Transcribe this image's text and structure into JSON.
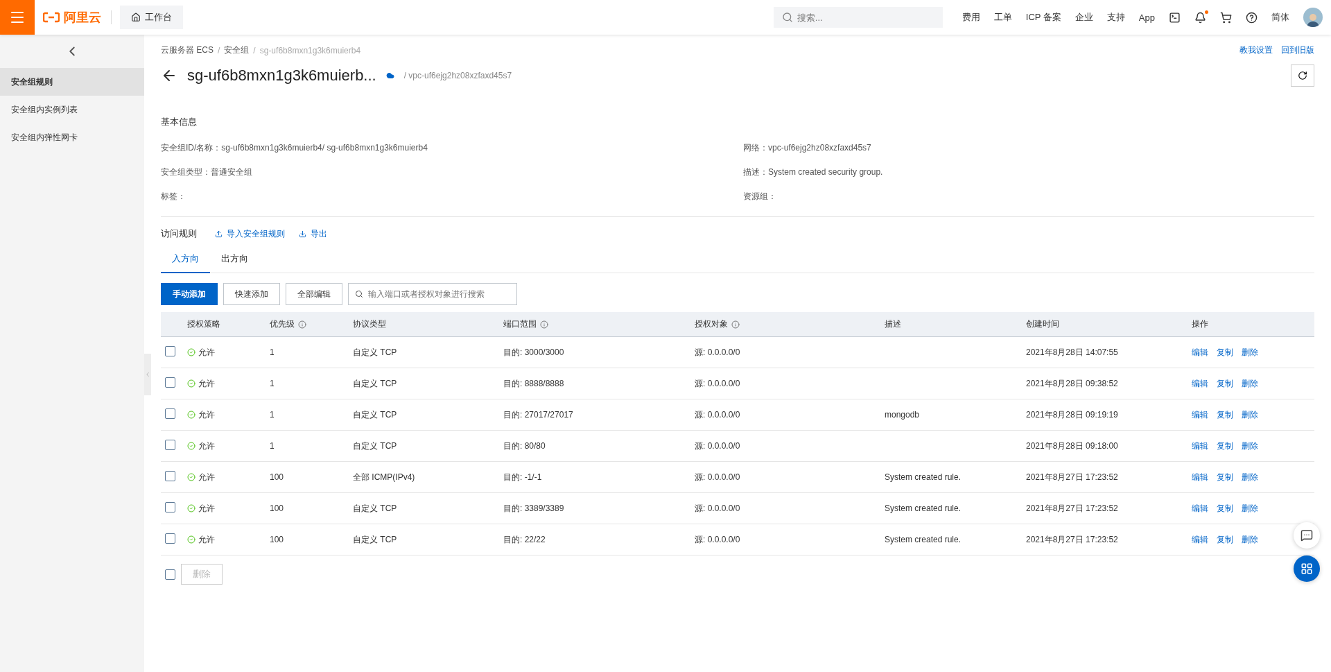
{
  "topbar": {
    "brand": "阿里云",
    "workbench": "工作台",
    "search": {
      "placeholder": "搜索..."
    },
    "links": [
      "费用",
      "工单",
      "ICP 备案",
      "企业",
      "支持",
      "App"
    ],
    "notification_dot": true,
    "language": "简体"
  },
  "sidebar": {
    "items": [
      {
        "label": "安全组规则",
        "selected": true
      },
      {
        "label": "安全组内实例列表",
        "selected": false
      },
      {
        "label": "安全组内弹性网卡",
        "selected": false
      }
    ]
  },
  "breadcrumb_separator": "/",
  "breadcrumb": [
    {
      "label": "云服务器 ECS",
      "current": false
    },
    {
      "label": "安全组",
      "current": false
    },
    {
      "label": "sg-uf6b8mxn1g3k6muierb4",
      "current": true
    }
  ],
  "header": {
    "title": "sg-uf6b8mxn1g3k6muierb...",
    "vpc": "/ vpc-uf6ejg2hz08xzfaxd45s7",
    "links": [
      "教我设置",
      "回到旧版"
    ]
  },
  "basic_info": {
    "title": "基本信息",
    "left": [
      {
        "label": "安全组ID/名称：",
        "value": "sg-uf6b8mxn1g3k6muierb4/ sg-uf6b8mxn1g3k6muierb4"
      },
      {
        "label": "安全组类型：",
        "value": "普通安全组"
      },
      {
        "label": "标签："
      }
    ],
    "right": [
      {
        "label": "网络：",
        "value": "vpc-uf6ejg2hz08xzfaxd45s7"
      },
      {
        "label": "描述：",
        "value": "System created security group."
      },
      {
        "label": "资源组："
      }
    ]
  },
  "access_rules": {
    "title": "访问规则",
    "actions": [
      "导入安全组规则",
      "导出"
    ]
  },
  "tabs": [
    {
      "label": "入方向",
      "selected": true
    },
    {
      "label": "出方向",
      "selected": false
    }
  ],
  "toolbar": {
    "buttons": [
      {
        "label": "手动添加",
        "kind": "primary"
      },
      {
        "label": "快速添加",
        "kind": "default"
      },
      {
        "label": "全部编辑",
        "kind": "default"
      }
    ],
    "search": {
      "placeholder": "输入端口或者授权对象进行搜索"
    }
  },
  "table": {
    "columns": [
      {
        "label": "授权策略",
        "info": false
      },
      {
        "label": "优先级",
        "info": true
      },
      {
        "label": "协议类型",
        "info": false
      },
      {
        "label": "端口范围",
        "info": true
      },
      {
        "label": "授权对象",
        "info": true
      },
      {
        "label": "描述",
        "info": false
      },
      {
        "label": "创建时间",
        "info": false
      },
      {
        "label": "操作",
        "info": false
      }
    ],
    "rows": [
      {
        "checked": false,
        "policy": "允许",
        "priority": "1",
        "protocol": "自定义 TCP",
        "port": "目的: 3000/3000",
        "source": "源: 0.0.0.0/0",
        "created": "2021年8月28日 14:07:55",
        "actions": [
          "编辑",
          "复制",
          "删除"
        ]
      },
      {
        "checked": false,
        "policy": "允许",
        "priority": "1",
        "protocol": "自定义 TCP",
        "port": "目的: 8888/8888",
        "source": "源: 0.0.0.0/0",
        "created": "2021年8月28日 09:38:52",
        "actions": [
          "编辑",
          "复制",
          "删除"
        ]
      },
      {
        "checked": false,
        "policy": "允许",
        "priority": "1",
        "protocol": "自定义 TCP",
        "port": "目的: 27017/27017",
        "source": "源: 0.0.0.0/0",
        "description": "mongodb",
        "created": "2021年8月28日 09:19:19",
        "actions": [
          "编辑",
          "复制",
          "删除"
        ]
      },
      {
        "checked": false,
        "policy": "允许",
        "priority": "1",
        "protocol": "自定义 TCP",
        "port": "目的: 80/80",
        "source": "源: 0.0.0.0/0",
        "created": "2021年8月28日 09:18:00",
        "actions": [
          "编辑",
          "复制",
          "删除"
        ]
      },
      {
        "checked": false,
        "policy": "允许",
        "priority": "100",
        "protocol": "全部 ICMP(IPv4)",
        "port": "目的: -1/-1",
        "source": "源: 0.0.0.0/0",
        "description": "System created rule.",
        "created": "2021年8月27日 17:23:52",
        "actions": [
          "编辑",
          "复制",
          "删除"
        ]
      },
      {
        "checked": false,
        "policy": "允许",
        "priority": "100",
        "protocol": "自定义 TCP",
        "port": "目的: 3389/3389",
        "source": "源: 0.0.0.0/0",
        "description": "System created rule.",
        "created": "2021年8月27日 17:23:52",
        "actions": [
          "编辑",
          "复制",
          "删除"
        ]
      },
      {
        "checked": false,
        "policy": "允许",
        "priority": "100",
        "protocol": "自定义 TCP",
        "port": "目的: 22/22",
        "source": "源: 0.0.0.0/0",
        "description": "System created rule.",
        "created": "2021年8月27日 17:23:52",
        "actions": [
          "编辑",
          "复制",
          "删除"
        ]
      }
    ]
  },
  "footer": {
    "checked": false,
    "delete_button": {
      "label": "删除",
      "disabled": true
    }
  }
}
